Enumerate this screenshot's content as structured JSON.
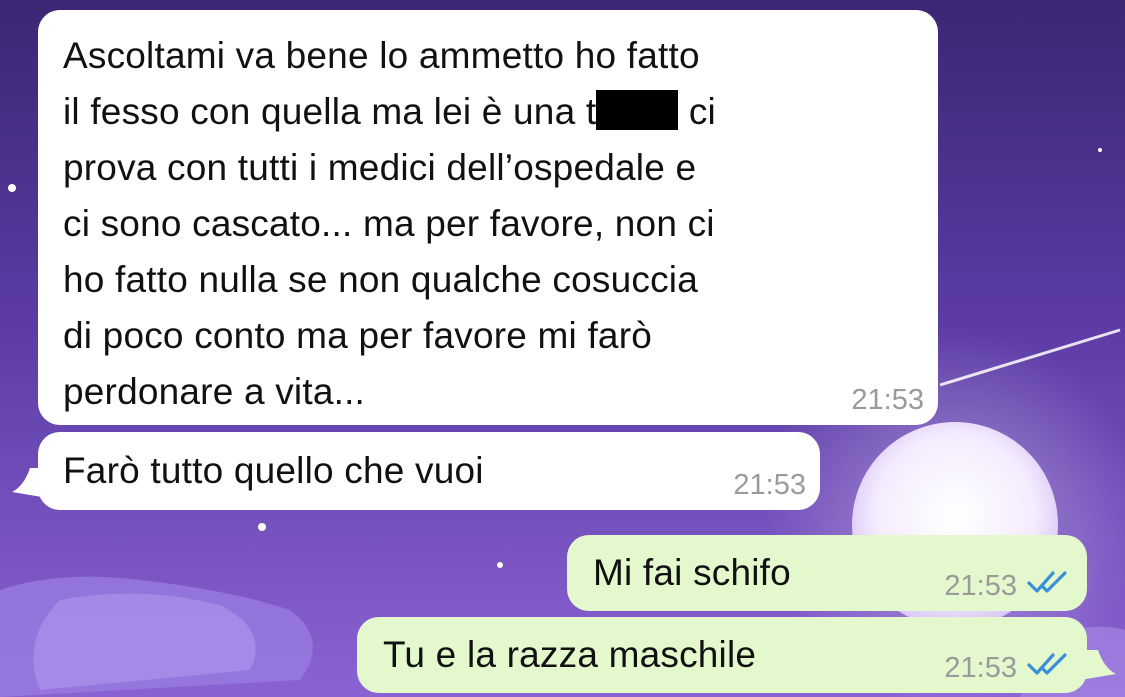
{
  "messages": [
    {
      "direction": "incoming",
      "lines": [
        "Ascoltami va bene lo ammetto ho fatto",
        "il fesso con quella ma lei è una t",
        "ci",
        "prova con tutti i medici dell’ospedale e",
        "ci sono cascato... ma per favore, non ci",
        "ho fatto nulla se non qualche cosuccia",
        "di poco conto ma per favore mi farò",
        "perdonare a vita..."
      ],
      "time": "21:53"
    },
    {
      "direction": "incoming",
      "text": "Farò tutto quello che vuoi",
      "time": "21:53"
    },
    {
      "direction": "outgoing",
      "text": "Mi fai schifo",
      "time": "21:53",
      "status": "read-double-check-icon"
    },
    {
      "direction": "outgoing",
      "text": "Tu e la razza maschile",
      "time": "21:53",
      "status": "read-double-check-icon"
    }
  ],
  "colors": {
    "incoming_bubble": "#ffffff",
    "outgoing_bubble": "#e4f8cd",
    "read_ticks": "#3a8fd8",
    "timestamp": "#9a9a9a"
  }
}
